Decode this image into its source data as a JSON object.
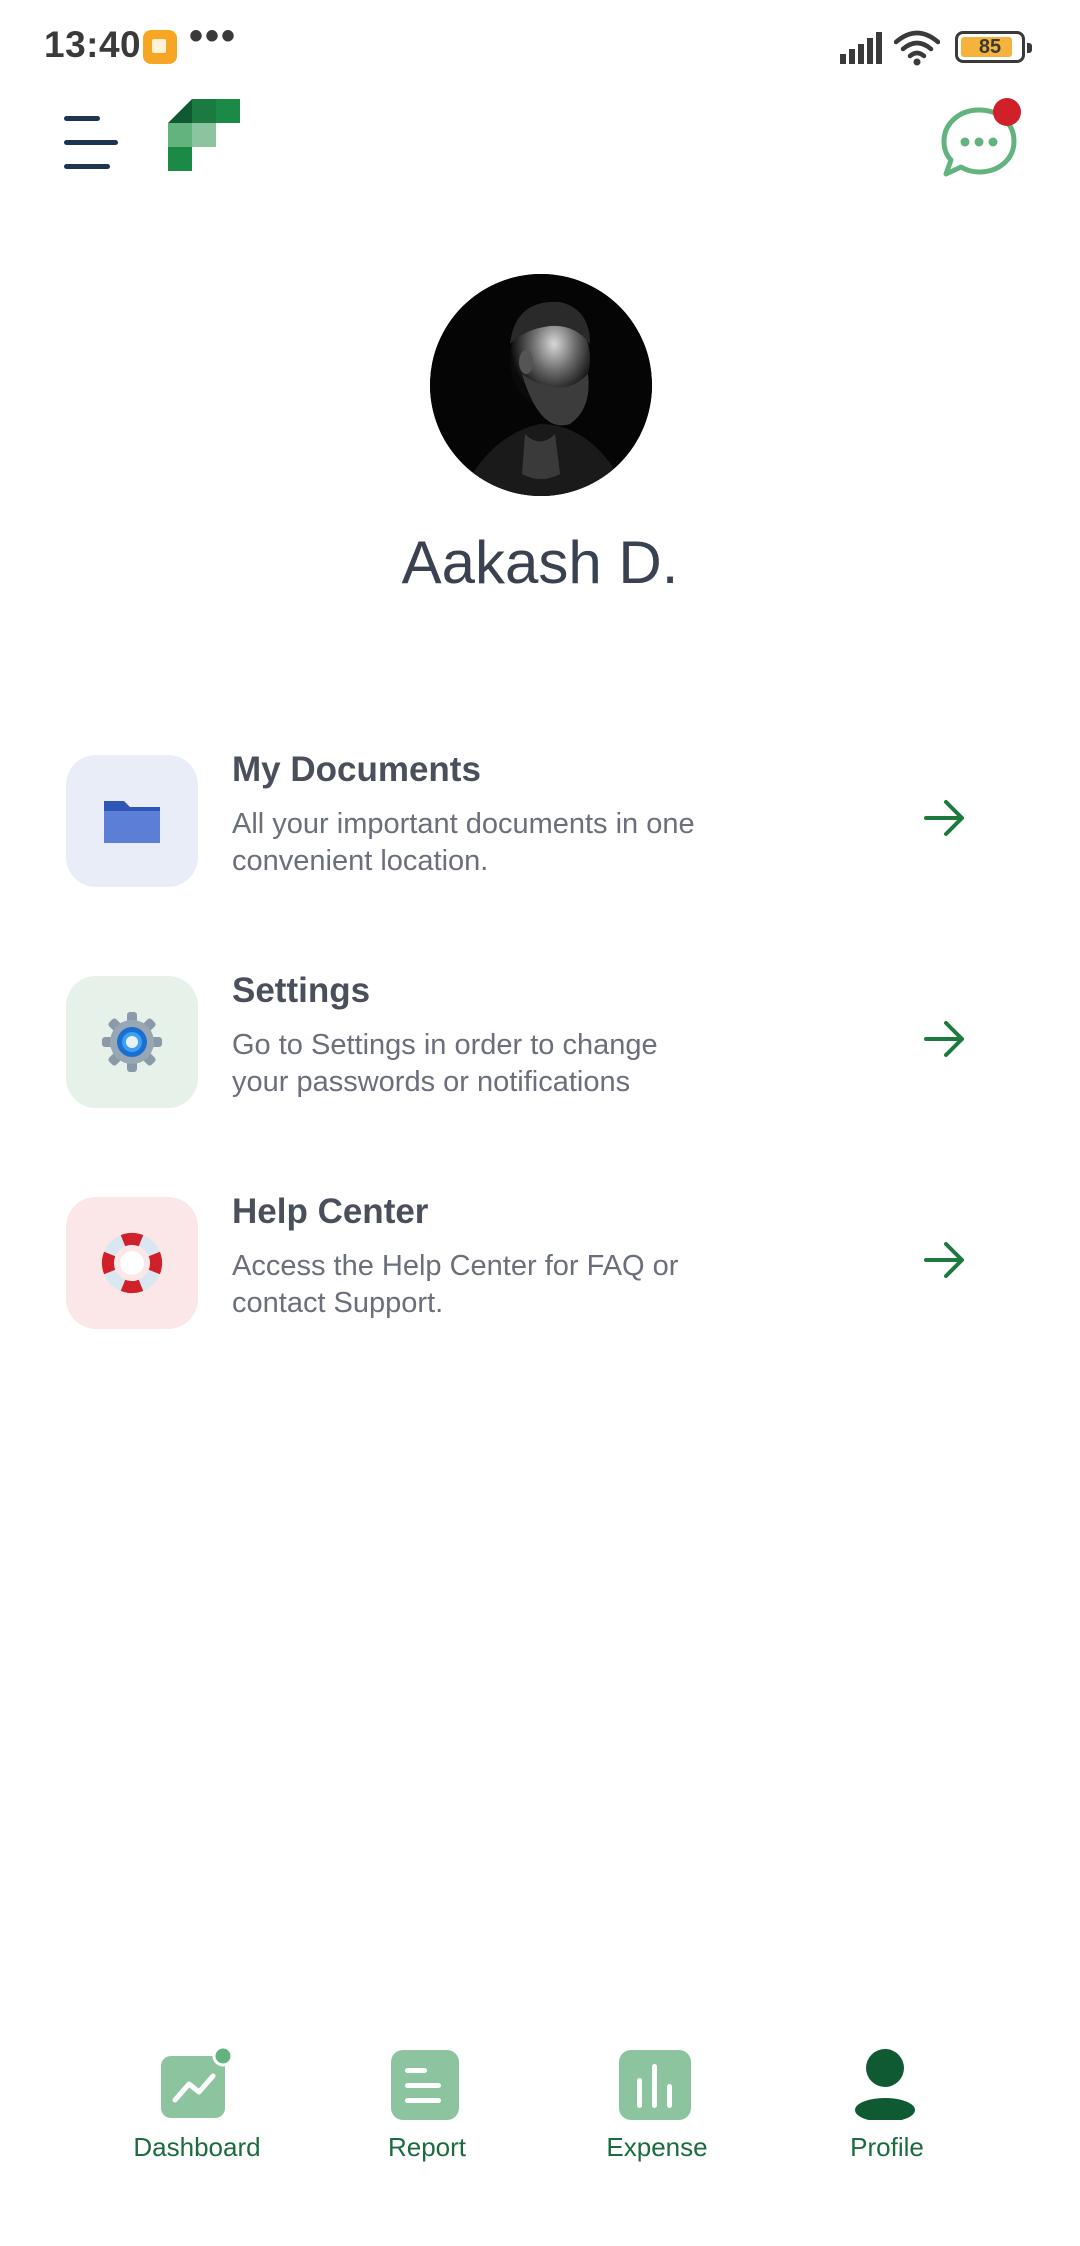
{
  "status_bar": {
    "time": "13:40",
    "more": "•••",
    "battery": "85"
  },
  "header": {
    "menu_icon": "hamburger-menu-icon",
    "logo_icon": "app-logo",
    "chat_icon": "chat-bubble-icon",
    "chat_badge_color": "#d0202a"
  },
  "profile": {
    "name": "Aakash D."
  },
  "menu": [
    {
      "title": "My Documents",
      "description": "All your important documents in one convenient location.",
      "icon": "folder-icon",
      "tile_color": "#e8edf8"
    },
    {
      "title": "Settings",
      "description": "Go to Settings in order to change your passwords or notifications",
      "icon": "gear-icon",
      "tile_color": "#e6f1e9"
    },
    {
      "title": "Help Center",
      "description": "Access the Help Center for FAQ or contact Support.",
      "icon": "lifebuoy-icon",
      "tile_color": "#fbe6e8"
    }
  ],
  "bottom_nav": [
    {
      "label": "Dashboard",
      "icon": "trend-chart-icon",
      "active": false
    },
    {
      "label": "Report",
      "icon": "report-icon",
      "active": false
    },
    {
      "label": "Expense",
      "icon": "bar-chart-icon",
      "active": false
    },
    {
      "label": "Profile",
      "icon": "person-icon",
      "active": true
    }
  ],
  "colors": {
    "accent": "#1c7a3e",
    "nav_inactive": "#8cc49f",
    "nav_active": "#0f5a32",
    "text_dark": "#3a4150"
  }
}
